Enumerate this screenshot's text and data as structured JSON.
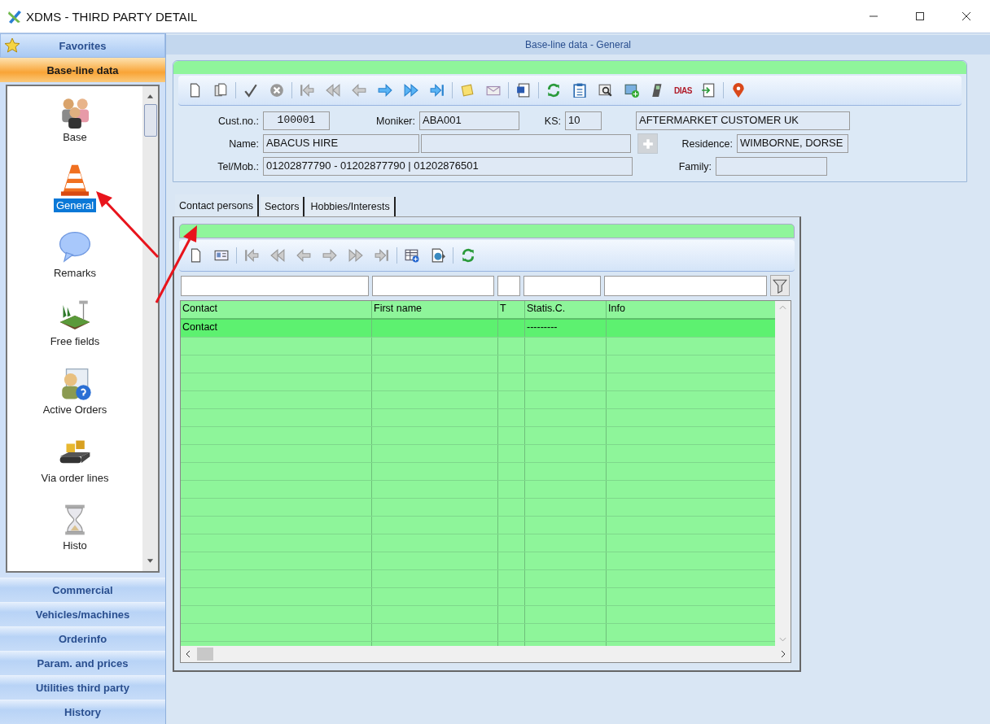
{
  "window": {
    "title": "XDMS - THIRD PARTY DETAIL"
  },
  "sidebar": {
    "favorites": "Favorites",
    "section": {
      "label": "Base-line data",
      "expanded": true
    },
    "items": [
      {
        "label": "Base",
        "selected": false
      },
      {
        "label": "General",
        "selected": true
      },
      {
        "label": "Remarks",
        "selected": false
      },
      {
        "label": "Free fields",
        "selected": false
      },
      {
        "label": "Active Orders",
        "selected": false
      },
      {
        "label": "Via order lines",
        "selected": false
      },
      {
        "label": "Histo",
        "selected": false
      }
    ],
    "groups": [
      "Commercial",
      "Vehicles/machines",
      "Orderinfo",
      "Param. and prices",
      "Utilities third party",
      "History"
    ]
  },
  "header": "Base-line data - General",
  "toolbar": {
    "logo_text": "DIAS"
  },
  "form": {
    "fields": [
      {
        "kind": "labeled",
        "label": "Cust.no.:",
        "value": "100001"
      },
      {
        "kind": "labeled",
        "label": "Moniker:",
        "value": "ABA001"
      },
      {
        "kind": "labeled",
        "label": "KS:",
        "value": "10"
      },
      {
        "kind": "plain",
        "value": "AFTERMARKET CUSTOMER UK"
      },
      {
        "kind": "labeled",
        "label": "Name:",
        "value": "ABACUS HIRE"
      },
      {
        "kind": "plain"
      },
      {
        "kind": "labeled",
        "label": "Residence:",
        "value": "WIMBORNE,  DORSE"
      },
      {
        "kind": "labeled",
        "label": "Tel/Mob.:",
        "value": "01202877790 - 01202877790 | 01202876501"
      },
      {
        "kind": "labeled",
        "label": "Family:"
      }
    ],
    "add_button": {
      "disabled": true
    }
  },
  "tabs": [
    {
      "label": "Contact persons",
      "selected": true
    },
    {
      "label": "Sectors",
      "selected": false
    },
    {
      "label": "Hobbies/Interests",
      "selected": false
    }
  ],
  "table": {
    "columns": [
      "Contact",
      "First name",
      "T",
      "Statis.C.",
      "Info"
    ],
    "rows": [
      {
        "cells": [
          "Contact",
          "",
          "",
          "---------",
          ""
        ],
        "selected": true
      }
    ]
  }
}
